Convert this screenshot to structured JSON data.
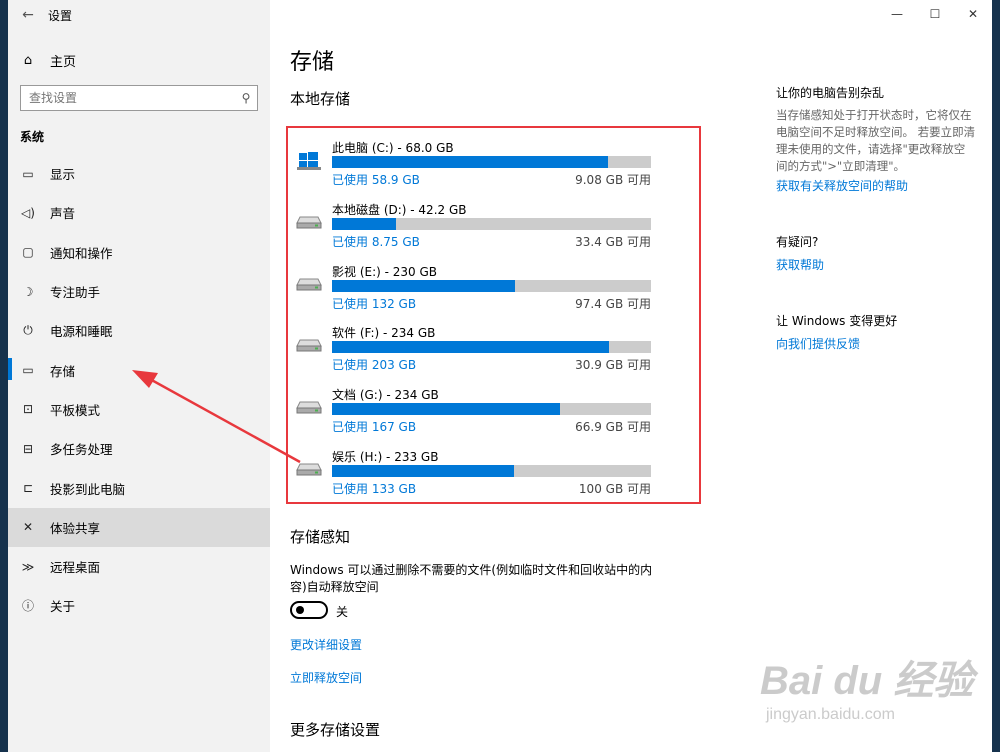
{
  "window": {
    "title": "设置",
    "back_icon": "←",
    "controls": {
      "minimize": "—",
      "maximize": "☐",
      "close": "✕"
    }
  },
  "sidebar": {
    "home_label": "主页",
    "search_placeholder": "查找设置",
    "section_title": "系统",
    "items": [
      {
        "label": "显示",
        "icon": "display-icon",
        "glyph": "▭"
      },
      {
        "label": "声音",
        "icon": "sound-icon",
        "glyph": "◁)"
      },
      {
        "label": "通知和操作",
        "icon": "notification-icon",
        "glyph": "▢"
      },
      {
        "label": "专注助手",
        "icon": "moon-icon",
        "glyph": "☽"
      },
      {
        "label": "电源和睡眠",
        "icon": "power-icon",
        "glyph": "⏻"
      },
      {
        "label": "存储",
        "icon": "storage-icon",
        "glyph": "▭"
      },
      {
        "label": "平板模式",
        "icon": "tablet-icon",
        "glyph": "⊡"
      },
      {
        "label": "多任务处理",
        "icon": "multitask-icon",
        "glyph": "⊟"
      },
      {
        "label": "投影到此电脑",
        "icon": "project-icon",
        "glyph": "⊏"
      },
      {
        "label": "体验共享",
        "icon": "share-icon",
        "glyph": "✕"
      },
      {
        "label": "远程桌面",
        "icon": "remote-icon",
        "glyph": "≫"
      },
      {
        "label": "关于",
        "icon": "info-icon",
        "glyph": "ⓘ"
      }
    ],
    "selected_index": 5,
    "hover_index": 9
  },
  "main": {
    "title": "存储",
    "local_storage_title": "本地存储",
    "drives": [
      {
        "name": "此电脑 (C:) - 68.0 GB",
        "used": "已使用 58.9 GB",
        "free": "9.08 GB 可用",
        "used_fraction": 0.866,
        "system": true
      },
      {
        "name": "本地磁盘 (D:) - 42.2 GB",
        "used": "已使用 8.75 GB",
        "free": "33.4 GB 可用",
        "used_fraction": 0.2,
        "system": false
      },
      {
        "name": "影视 (E:) - 230 GB",
        "used": "已使用 132 GB",
        "free": "97.4 GB 可用",
        "used_fraction": 0.574,
        "system": false
      },
      {
        "name": "软件 (F:) - 234 GB",
        "used": "已使用 203 GB",
        "free": "30.9 GB 可用",
        "used_fraction": 0.868,
        "system": false
      },
      {
        "name": "文档 (G:) - 234 GB",
        "used": "已使用 167 GB",
        "free": "66.9 GB 可用",
        "used_fraction": 0.714,
        "system": false
      },
      {
        "name": "娱乐 (H:) - 233 GB",
        "used": "已使用 133 GB",
        "free": "100 GB 可用",
        "used_fraction": 0.571,
        "system": false
      }
    ],
    "sense_title": "存储感知",
    "sense_desc": "Windows 可以通过删除不需要的文件(例如临时文件和回收站中的内容)自动释放空间",
    "toggle_label": "关",
    "toggle_on": false,
    "change_settings_link": "更改详细设置",
    "free_now_link": "立即释放空间",
    "more_title": "更多存储设置"
  },
  "right": {
    "tip_head": "让你的电脑告别杂乱",
    "tip_text": "当存储感知处于打开状态时，它将仅在电脑空间不足时释放空间。 若要立即清理未使用的文件，请选择\"更改释放空间的方式\">\"立即清理\"。",
    "tip_link": "获取有关释放空间的帮助",
    "question_head": "有疑问?",
    "question_link": "获取帮助",
    "feedback_head": "让 Windows 变得更好",
    "feedback_link": "向我们提供反馈"
  },
  "annotation": {
    "highlight_color": "#e8383d",
    "accent_color": "#0078d7"
  },
  "watermark": {
    "brand": "Bai du 经验",
    "url": "jingyan.baidu.com"
  }
}
